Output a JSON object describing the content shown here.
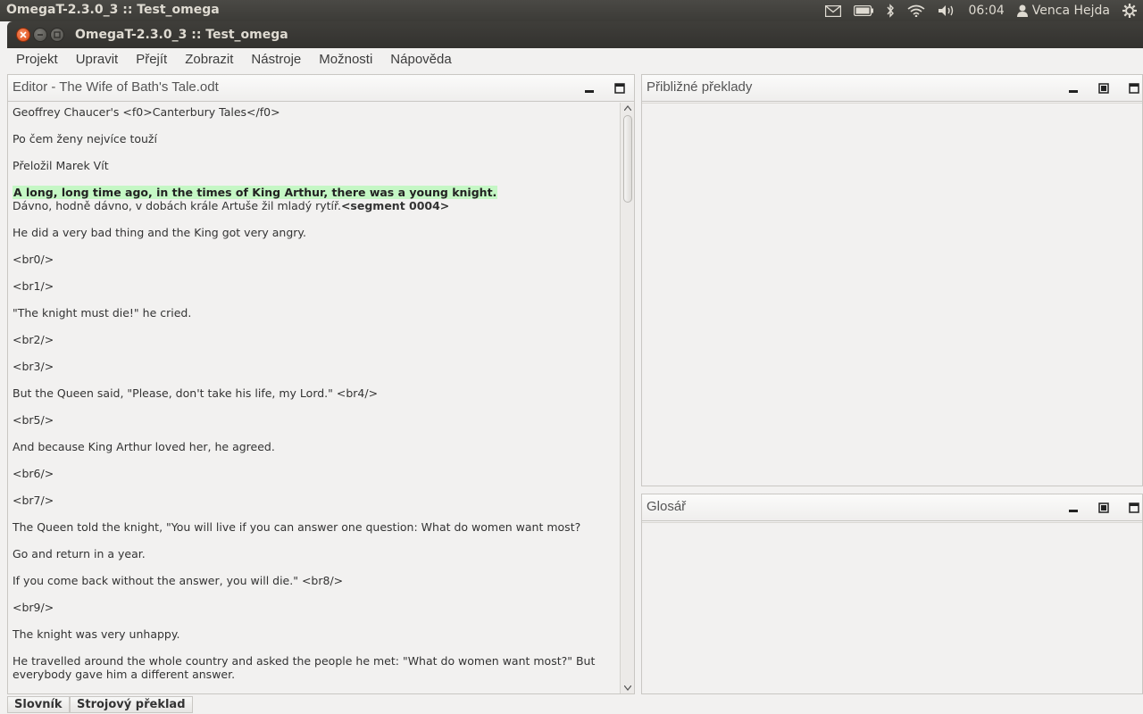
{
  "panel": {
    "app_title": "OmegaT-2.3.0_3 :: Test_omega",
    "clock": "06:04",
    "user": "Venca Hejda",
    "icons": [
      "mail-icon",
      "battery-icon",
      "bluetooth-icon",
      "wifi-icon",
      "volume-icon",
      "user-icon",
      "gear-icon"
    ]
  },
  "window": {
    "title": "OmegaT-2.3.0_3 :: Test_omega"
  },
  "menu": {
    "items": [
      "Projekt",
      "Upravit",
      "Přejít",
      "Zobrazit",
      "Nástroje",
      "Možnosti",
      "Nápověda"
    ]
  },
  "editor": {
    "title": "Editor - The Wife of Bath's Tale.odt",
    "segments": [
      "Geoffrey Chaucer's <f0>Canterbury Tales</f0>",
      "Po čem ženy nejvíce touží",
      "Přeložil Marek Vít",
      "He did a very bad thing and the King got very angry.",
      "<br0/>",
      "<br1/>",
      "\"The knight must die!\" he cried.",
      "<br2/>",
      "<br3/>",
      "But the Queen said, \"Please, don't take his life, my Lord.\" <br4/>",
      "<br5/>",
      "And because King Arthur loved her, he agreed.",
      "<br6/>",
      "<br7/>",
      "The Queen told the knight, \"You will live if you can answer one question: What do women want most?",
      "Go and return in a year.",
      "If you come back without the answer, you will die.\" <br8/>",
      "<br9/>",
      "The knight was very unhappy.",
      "He travelled around the whole country and asked the people he met: \"What do women want most?\" But",
      "everybody gave him a different answer."
    ],
    "active_source": "A long, long time ago, in the times of King Arthur, there was a young knight.",
    "active_target": "Dávno, hodně dávno, v dobách krále Artuše žil mladý rytíř.",
    "active_marker": "<segment 0004>"
  },
  "fuzzy": {
    "title": "Přibližné překlady"
  },
  "glossary": {
    "title": "Glosář"
  },
  "bottom_tabs": {
    "dictionary": "Slovník",
    "machine_translation": "Strojový překlad"
  },
  "colors": {
    "active_segment_bg": "#c5f7c5",
    "panel_bg": "#3c3b37",
    "close_button": "#dd4814"
  }
}
